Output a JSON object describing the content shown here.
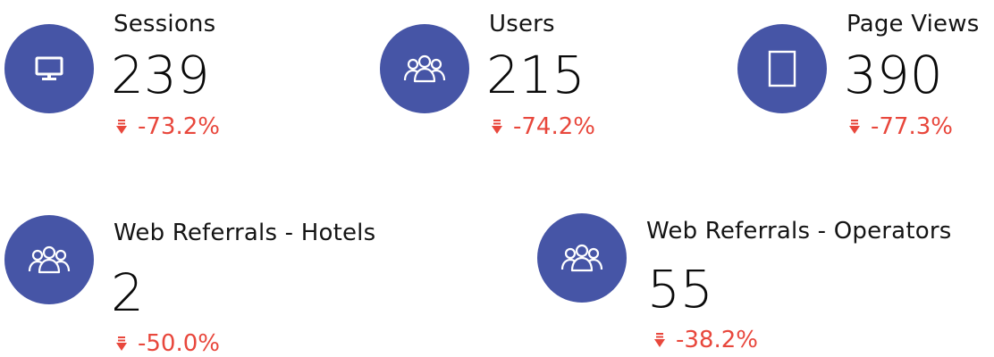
{
  "colors": {
    "icon_circle": "#4655a6",
    "negative_delta": "#e8473c",
    "text": "#141414"
  },
  "metrics": [
    {
      "label": "Sessions",
      "value": "239",
      "delta": "-73.2%",
      "icon": "desktop-monitor-icon",
      "trend": "down"
    },
    {
      "label": "Users",
      "value": "215",
      "delta": "-74.2%",
      "icon": "users-group-icon",
      "trend": "down"
    },
    {
      "label": "Page Views",
      "value": "390",
      "delta": "-77.3%",
      "icon": "tablet-page-icon",
      "trend": "down"
    },
    {
      "label": "Web Referrals - Hotels",
      "value": "2",
      "delta": "-50.0%",
      "icon": "users-group-icon",
      "trend": "down"
    },
    {
      "label": "Web Referrals - Operators",
      "value": "55",
      "delta": "-38.2%",
      "icon": "users-group-icon",
      "trend": "down"
    }
  ]
}
